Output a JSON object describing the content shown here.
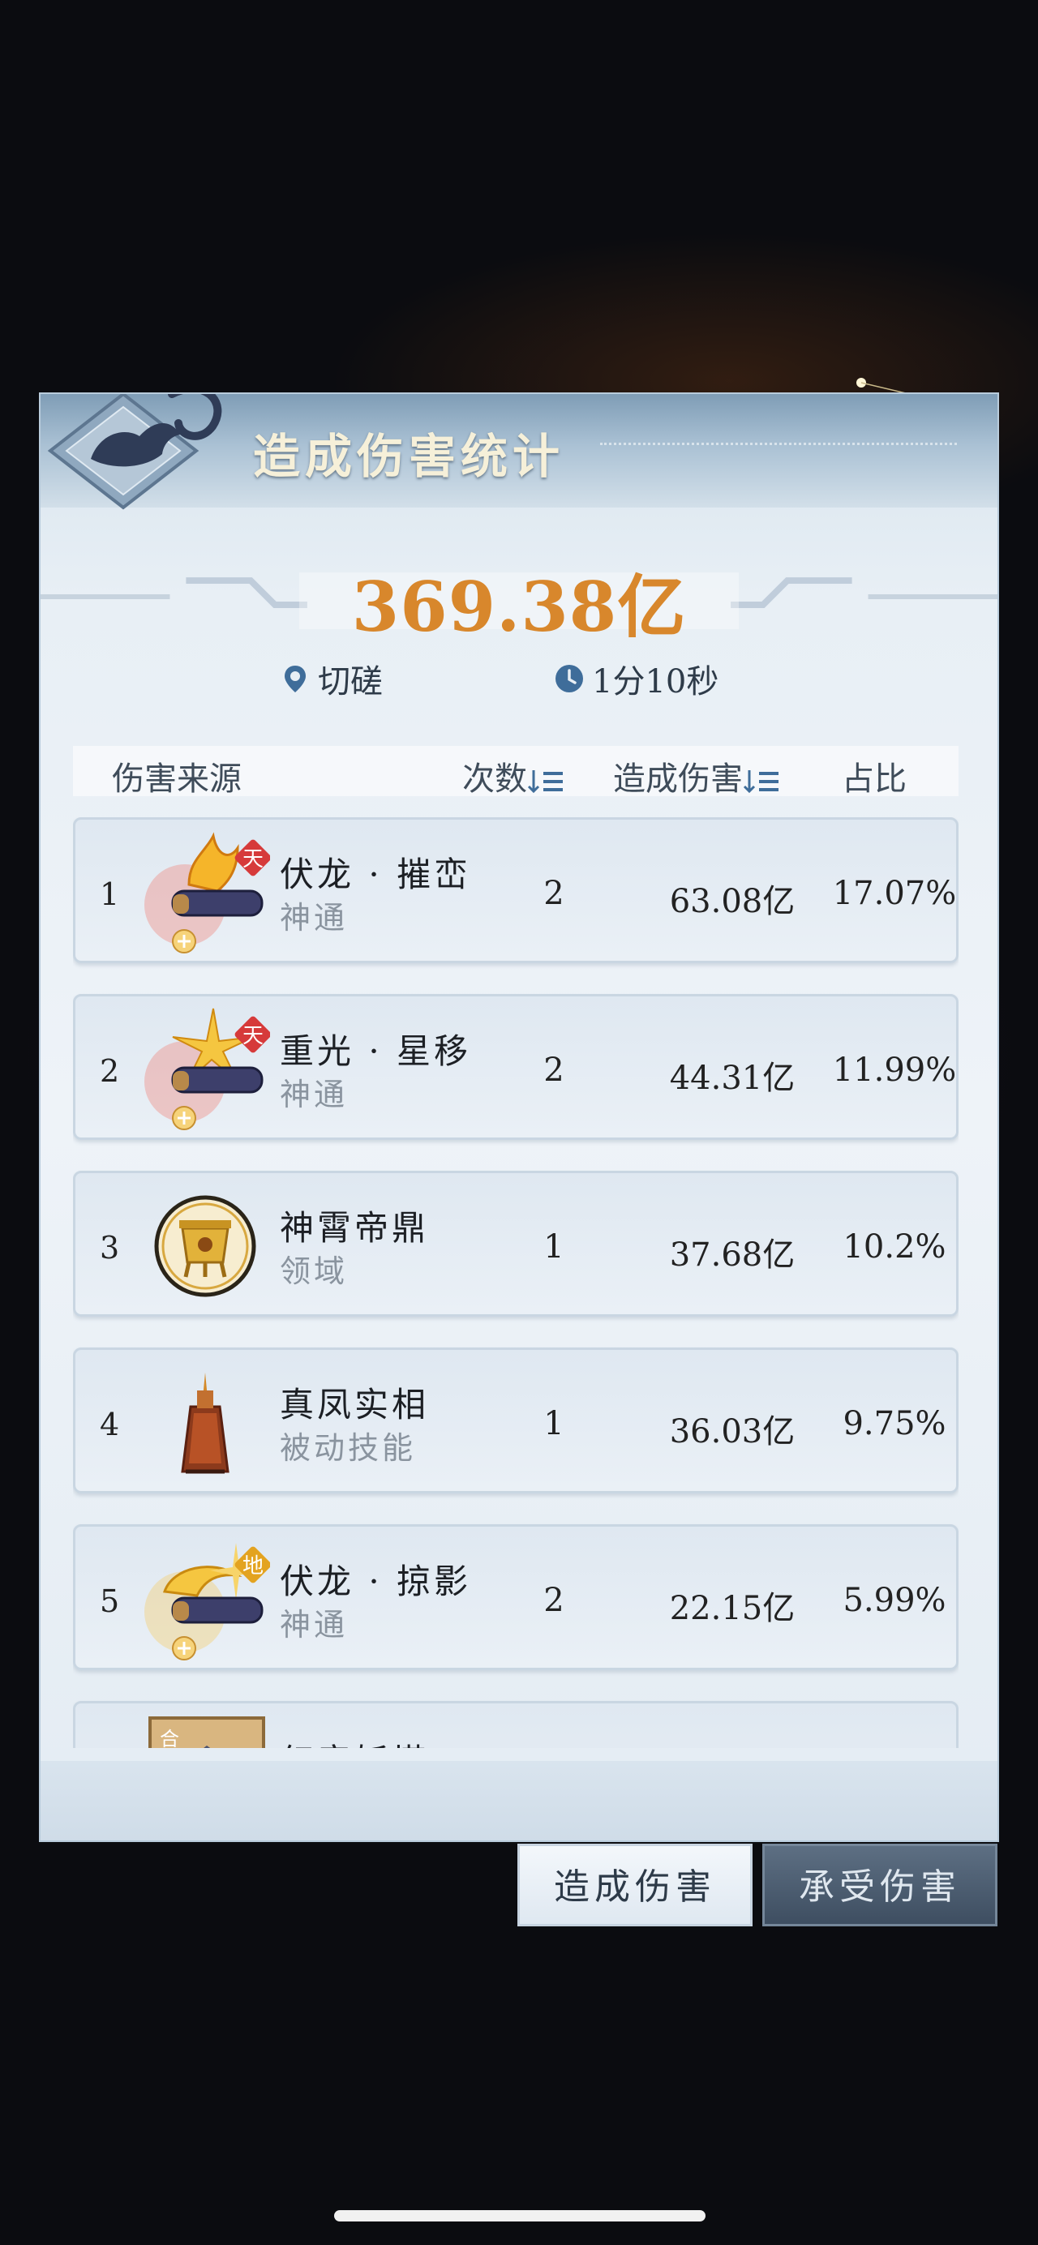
{
  "panel": {
    "title": "造成伤害统计",
    "total_damage": "369.38亿",
    "location": "切磋",
    "duration": "1分10秒"
  },
  "columns": {
    "source": "伤害来源",
    "count": "次数",
    "damage": "造成伤害",
    "ratio": "占比"
  },
  "rows": [
    {
      "rank": "1",
      "name": "伏龙 · 摧峦",
      "type": "神通",
      "count": "2",
      "damage": "63.08亿",
      "ratio": "17.07%",
      "badge": "天",
      "icon": "flame-scroll-icon"
    },
    {
      "rank": "2",
      "name": "重光 · 星移",
      "type": "神通",
      "count": "2",
      "damage": "44.31亿",
      "ratio": "11.99%",
      "badge": "天",
      "icon": "star-scroll-icon"
    },
    {
      "rank": "3",
      "name": "神霄帝鼎",
      "type": "领域",
      "count": "1",
      "damage": "37.68亿",
      "ratio": "10.2%",
      "icon": "golden-cauldron-icon"
    },
    {
      "rank": "4",
      "name": "真凤实相",
      "type": "被动技能",
      "count": "1",
      "damage": "36.03亿",
      "ratio": "9.75%",
      "icon": "phoenix-figure-icon"
    },
    {
      "rank": "5",
      "name": "伏龙 · 掠影",
      "type": "神通",
      "count": "2",
      "damage": "22.15亿",
      "ratio": "5.99%",
      "badge": "地",
      "icon": "dragon-scroll-icon"
    }
  ],
  "partial_row": {
    "name": "幻音妖塔",
    "badge": "合"
  },
  "tabs": {
    "dealt": "造成伤害",
    "taken": "承受伤害"
  },
  "colors": {
    "total": "#d8872c",
    "badge_red": "#d63a3a",
    "badge_gold": "#e3a320"
  }
}
